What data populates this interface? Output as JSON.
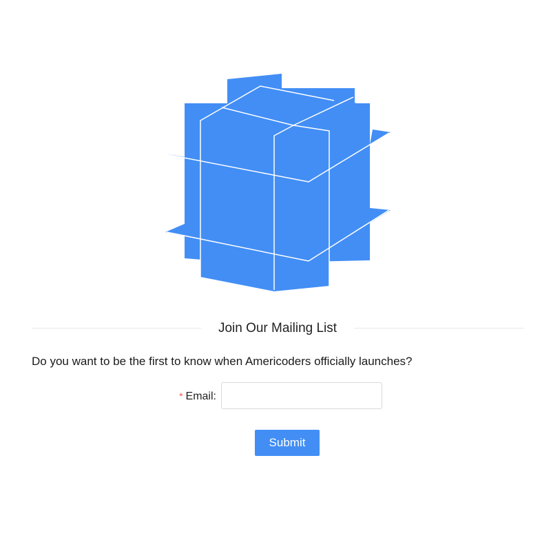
{
  "brand": {
    "logo_name": "cube-logo",
    "accent_color": "#428ef5"
  },
  "form": {
    "section_title": "Join Our Mailing List",
    "question": "Do you want to be the first to know when Americoders officially launches?",
    "email_required_mark": "*",
    "email_label": "Email",
    "email_colon": ":",
    "email_value": "",
    "submit_label": "Submit"
  }
}
